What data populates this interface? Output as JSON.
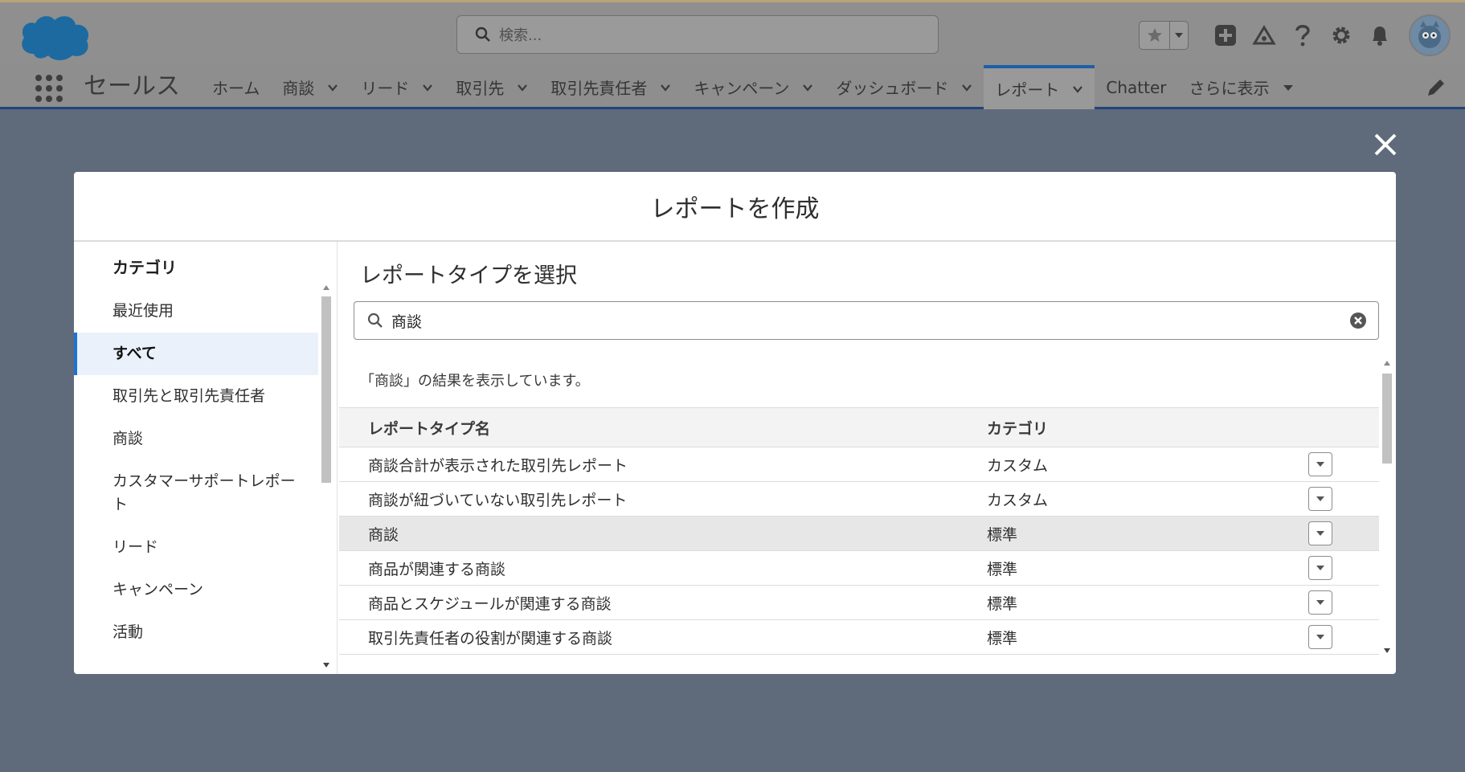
{
  "header": {
    "search_placeholder": "検索...",
    "icons": [
      "salesforce-cloud-logo",
      "search-icon",
      "star-icon",
      "chevron-down-icon",
      "add-icon",
      "trailhead-icon",
      "help-icon",
      "gear-icon",
      "bell-icon",
      "avatar"
    ]
  },
  "nav": {
    "app_name": "セールス",
    "tabs": [
      {
        "label": "ホーム",
        "has_menu": false
      },
      {
        "label": "商談",
        "has_menu": true
      },
      {
        "label": "リード",
        "has_menu": true
      },
      {
        "label": "取引先",
        "has_menu": true
      },
      {
        "label": "取引先責任者",
        "has_menu": true
      },
      {
        "label": "キャンペーン",
        "has_menu": true
      },
      {
        "label": "ダッシュボード",
        "has_menu": true
      },
      {
        "label": "レポート",
        "has_menu": true,
        "active": true
      },
      {
        "label": "Chatter",
        "has_menu": false
      },
      {
        "label": "さらに表示",
        "has_menu": true
      }
    ]
  },
  "modal": {
    "title": "レポートを作成",
    "categories": {
      "heading": "カテゴリ",
      "items": [
        {
          "label": "最近使用"
        },
        {
          "label": "すべて",
          "selected": true
        },
        {
          "label": "取引先と取引先責任者"
        },
        {
          "label": "商談"
        },
        {
          "label": "カスタマーサポートレポート"
        },
        {
          "label": "リード"
        },
        {
          "label": "キャンペーン"
        },
        {
          "label": "活動"
        }
      ]
    },
    "report_types": {
      "heading": "レポートタイプを選択",
      "search_value": "商談",
      "results_note": "「商談」の結果を表示しています。",
      "columns": [
        "レポートタイプ名",
        "カテゴリ"
      ],
      "rows": [
        {
          "name": "商談合計が表示された取引先レポート",
          "category": "カスタム"
        },
        {
          "name": "商談が紐づいていない取引先レポート",
          "category": "カスタム"
        },
        {
          "name": "商談",
          "category": "標準",
          "highlighted": true
        },
        {
          "name": "商品が関連する商談",
          "category": "標準"
        },
        {
          "name": "商品とスケジュールが関連する商談",
          "category": "標準"
        },
        {
          "name": "取引先責任者の役割が関連する商談",
          "category": "標準"
        }
      ]
    }
  },
  "colors": {
    "overlay": "#5f6b7b",
    "header_dimmed": "#8f8f8f",
    "brand_blue": "#1b73d6",
    "selected_bg": "#eaf1fb",
    "nav_active_border": "#1e5fa8"
  }
}
